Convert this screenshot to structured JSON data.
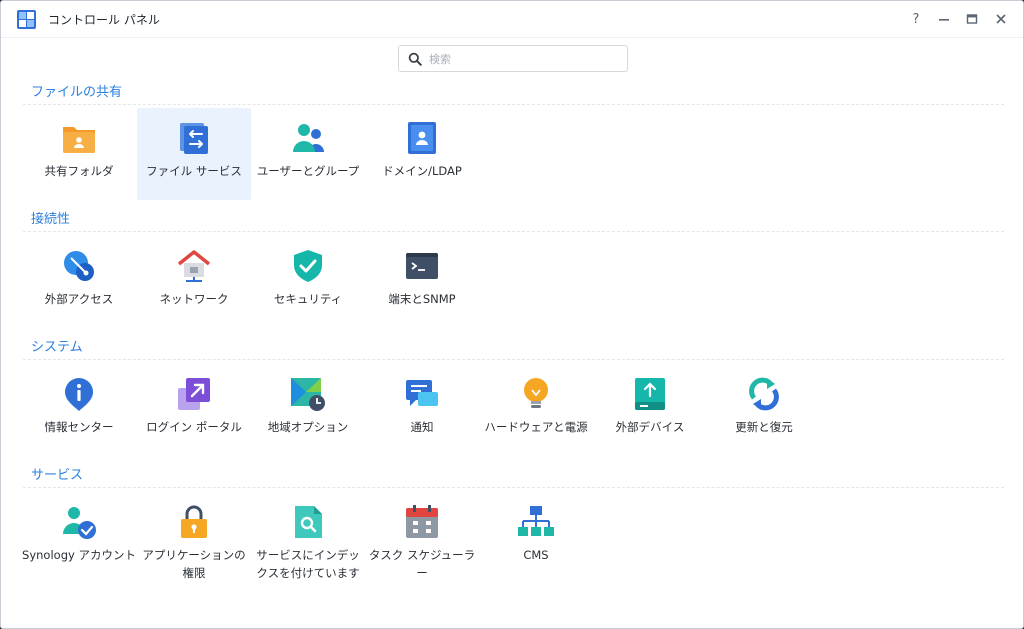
{
  "window": {
    "title": "コントロール パネル",
    "controls": {
      "help": "?",
      "minimize": "—",
      "maximize": "▭",
      "close": "✕"
    }
  },
  "search": {
    "placeholder": "検索",
    "value": ""
  },
  "accent_color": "#2b80e0",
  "sections": [
    {
      "title": "ファイルの共有",
      "items": [
        {
          "label": "共有フォルダ",
          "icon": "shared-folder-icon"
        },
        {
          "label": "ファイル サービス",
          "icon": "file-services-icon",
          "selected": true
        },
        {
          "label": "ユーザーとグループ",
          "icon": "user-group-icon"
        },
        {
          "label": "ドメイン/LDAP",
          "icon": "domain-ldap-icon"
        }
      ]
    },
    {
      "title": "接続性",
      "items": [
        {
          "label": "外部アクセス",
          "icon": "external-access-icon"
        },
        {
          "label": "ネットワーク",
          "icon": "network-icon"
        },
        {
          "label": "セキュリティ",
          "icon": "security-shield-icon"
        },
        {
          "label": "端末とSNMP",
          "icon": "terminal-icon"
        }
      ]
    },
    {
      "title": "システム",
      "items": [
        {
          "label": "情報センター",
          "icon": "info-center-icon"
        },
        {
          "label": "ログイン ポータル",
          "icon": "login-portal-icon"
        },
        {
          "label": "地域オプション",
          "icon": "regional-options-icon"
        },
        {
          "label": "通知",
          "icon": "notification-icon"
        },
        {
          "label": "ハードウェアと電源",
          "icon": "hardware-power-icon"
        },
        {
          "label": "外部デバイス",
          "icon": "external-devices-icon"
        },
        {
          "label": "更新と復元",
          "icon": "update-restore-icon"
        }
      ]
    },
    {
      "title": "サービス",
      "items": [
        {
          "label": "Synology アカウント",
          "icon": "synology-account-icon"
        },
        {
          "label": "アプリケーションの権限",
          "icon": "application-privileges-icon"
        },
        {
          "label": "サービスにインデックスを付けています",
          "icon": "indexing-service-icon"
        },
        {
          "label": "タスク スケジューラー",
          "icon": "task-scheduler-icon"
        },
        {
          "label": "CMS",
          "icon": "cms-icon"
        }
      ]
    }
  ]
}
